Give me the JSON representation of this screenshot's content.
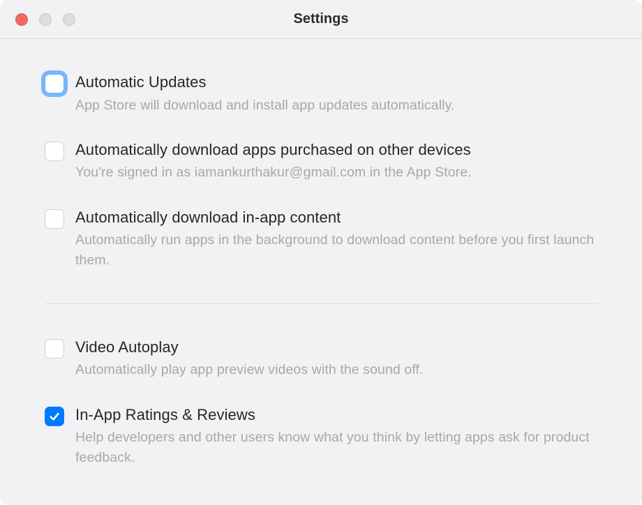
{
  "window": {
    "title": "Settings"
  },
  "settings": {
    "automatic_updates": {
      "label": "Automatic Updates",
      "desc": "App Store will download and install app updates automatically.",
      "checked": false,
      "focused": true
    },
    "auto_download_other_devices": {
      "label": "Automatically download apps purchased on other devices",
      "desc": "You're signed in as iamankurthakur@gmail.com in the App Store.",
      "checked": false,
      "focused": false
    },
    "auto_download_inapp_content": {
      "label": "Automatically download in-app content",
      "desc": "Automatically run apps in the background to download content before you first launch them.",
      "checked": false,
      "focused": false
    },
    "video_autoplay": {
      "label": "Video Autoplay",
      "desc": "Automatically play app preview videos with the sound off.",
      "checked": false,
      "focused": false
    },
    "inapp_ratings_reviews": {
      "label": "In-App Ratings & Reviews",
      "desc": "Help developers and other users know what you think by letting apps ask for product feedback.",
      "checked": true,
      "focused": false
    }
  }
}
